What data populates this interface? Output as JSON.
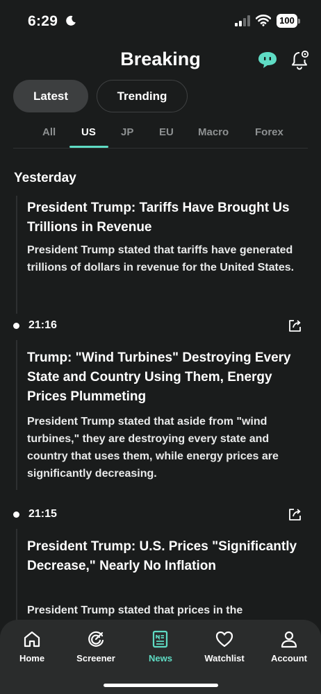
{
  "status_bar": {
    "time": "6:29",
    "battery": "100"
  },
  "header": {
    "title": "Breaking"
  },
  "segments": [
    {
      "label": "Latest"
    },
    {
      "label": "Trending"
    }
  ],
  "region_tabs": [
    {
      "label": "All"
    },
    {
      "label": "US"
    },
    {
      "label": "JP"
    },
    {
      "label": "EU"
    },
    {
      "label": "Macro"
    },
    {
      "label": "Forex"
    }
  ],
  "active_region_tab": "US",
  "feed": {
    "day_header": "Yesterday",
    "items": [
      {
        "time": "",
        "title": "President Trump: Tariffs Have Brought Us Trillions in Revenue",
        "body": "President Trump stated that tariffs have generated trillions of dollars in revenue for the United States."
      },
      {
        "time": "21:16",
        "title": "Trump: \"Wind Turbines\" Destroying Every State and Country Using Them, Energy Prices Plummeting",
        "body": "President Trump stated that aside from \"wind turbines,\" they are destroying every state and country that uses them, while energy prices are significantly decreasing."
      },
      {
        "time": "21:15",
        "title": "President Trump: U.S. Prices \"Significantly Decrease,\" Nearly No Inflation",
        "body": "President Trump stated that prices in the"
      }
    ]
  },
  "bottom_nav": [
    {
      "label": "Home",
      "icon": "home-icon"
    },
    {
      "label": "Screener",
      "icon": "screener-icon"
    },
    {
      "label": "News",
      "icon": "news-icon"
    },
    {
      "label": "Watchlist",
      "icon": "heart-icon"
    },
    {
      "label": "Account",
      "icon": "person-icon"
    }
  ],
  "active_nav": "News",
  "colors": {
    "accent": "#5fdcc4",
    "background": "#1a1c1c",
    "nav_background": "#2a2c2c"
  }
}
